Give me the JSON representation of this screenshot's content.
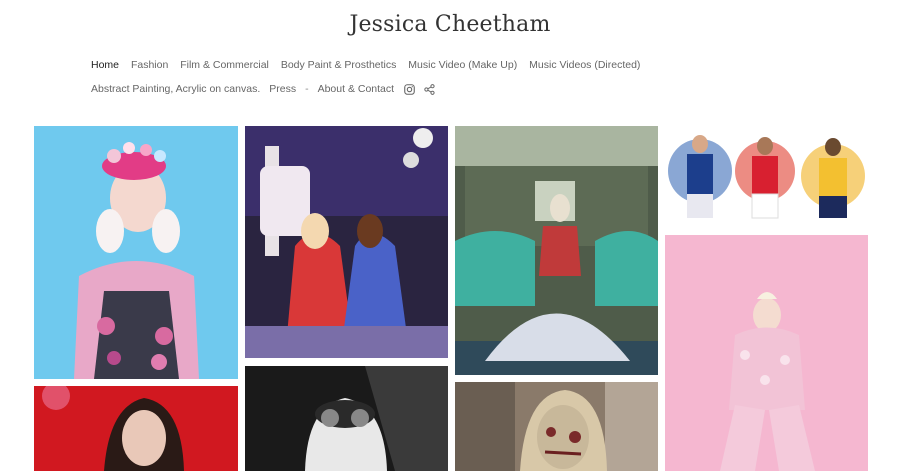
{
  "site": {
    "title": "Jessica Cheetham"
  },
  "nav": {
    "row1": [
      {
        "label": "Home",
        "active": true
      },
      {
        "label": "Fashion"
      },
      {
        "label": "Film & Commercial"
      },
      {
        "label": "Body Paint & Prosthetics"
      },
      {
        "label": "Music Video (Make Up)"
      },
      {
        "label": "Music Videos (Directed)"
      }
    ],
    "row2": [
      {
        "label": "Abstract Painting, Acrylic on canvas."
      },
      {
        "label": "Press"
      },
      {
        "label": "-"
      },
      {
        "label": "About & Contact"
      }
    ],
    "icons": [
      "instagram-icon",
      "share-icon"
    ]
  },
  "gallery": {
    "tiles": [
      {
        "name": "portrait-pink-hat",
        "bg": "#6fc9ee"
      },
      {
        "name": "stage-performers",
        "bg": "#2a2440"
      },
      {
        "name": "ornate-room-gown",
        "bg": "#4f5c4a"
      },
      {
        "name": "footballers-paint",
        "bg": "#ffffff"
      },
      {
        "name": "pink-fashion-figure",
        "bg": "#f5b7d0"
      },
      {
        "name": "red-bg-portrait",
        "bg": "#d11820"
      },
      {
        "name": "bw-portrait",
        "bg": "#1a1a1a"
      },
      {
        "name": "zombie-makeup",
        "bg": "#8a7a6a"
      }
    ]
  }
}
